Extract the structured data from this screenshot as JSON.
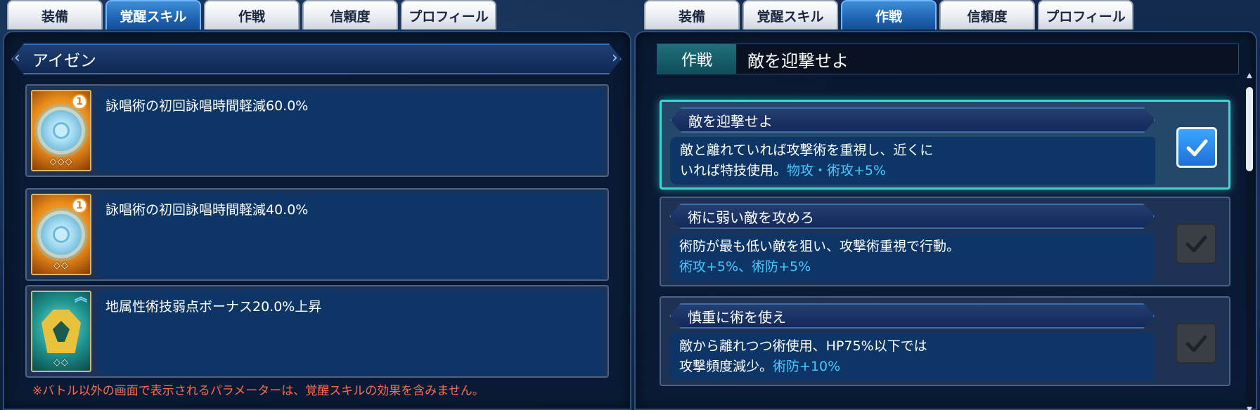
{
  "left": {
    "tabs": [
      {
        "label": "装備",
        "active": false
      },
      {
        "label": "覚醒スキル",
        "active": true
      },
      {
        "label": "作戦",
        "active": false
      },
      {
        "label": "信頼度",
        "active": false
      },
      {
        "label": "プロフィール",
        "active": false
      }
    ],
    "character_name": "アイゼン",
    "skills": [
      {
        "icon": "gear-icon",
        "badge": "1",
        "diamonds": "◇◇◇",
        "description": "詠唱術の初回詠唱時間軽減60.0%"
      },
      {
        "icon": "gear-icon",
        "badge": "1",
        "diamonds": "◇◇",
        "description": "詠唱術の初回詠唱時間軽減40.0%"
      },
      {
        "icon": "shield-icon",
        "badge": "︽",
        "diamonds": "◇◇",
        "description": "地属性術技弱点ボーナス20.0%上昇"
      }
    ],
    "note": "※バトル以外の画面で表示されるパラメーターは、覚醒スキルの効果を含みません。"
  },
  "right": {
    "tabs": [
      {
        "label": "装備",
        "active": false
      },
      {
        "label": "覚醒スキル",
        "active": false
      },
      {
        "label": "作戦",
        "active": true
      },
      {
        "label": "信頼度",
        "active": false
      },
      {
        "label": "プロフィール",
        "active": false
      }
    ],
    "strategy_label": "作戦",
    "strategy_value": "敵を迎撃せよ",
    "tactics": [
      {
        "title": "敵を迎撃せよ",
        "line1": "敵と離れていれば攻撃術を重視し、近くに",
        "line2_prefix": "いれば特技使用。",
        "bonus": "物攻・術攻+5%",
        "selected": true
      },
      {
        "title": "術に弱い敵を攻めろ",
        "line1": "術防が最も低い敵を狙い、攻撃術重視で行動。",
        "line2_prefix": "",
        "bonus": "術攻+5%、術防+5%",
        "selected": false
      },
      {
        "title": "慎重に術を使え",
        "line1": "敵から離れつつ術使用、HP75%以下では",
        "line2_prefix": "攻撃頻度減少。",
        "bonus": "術防+10%",
        "selected": false
      }
    ]
  },
  "colors": {
    "accent_cyan": "#38d9d3",
    "bonus_blue": "#45c8ff",
    "note_red": "#ff6b4e",
    "tab_active": "#1f63b2"
  }
}
